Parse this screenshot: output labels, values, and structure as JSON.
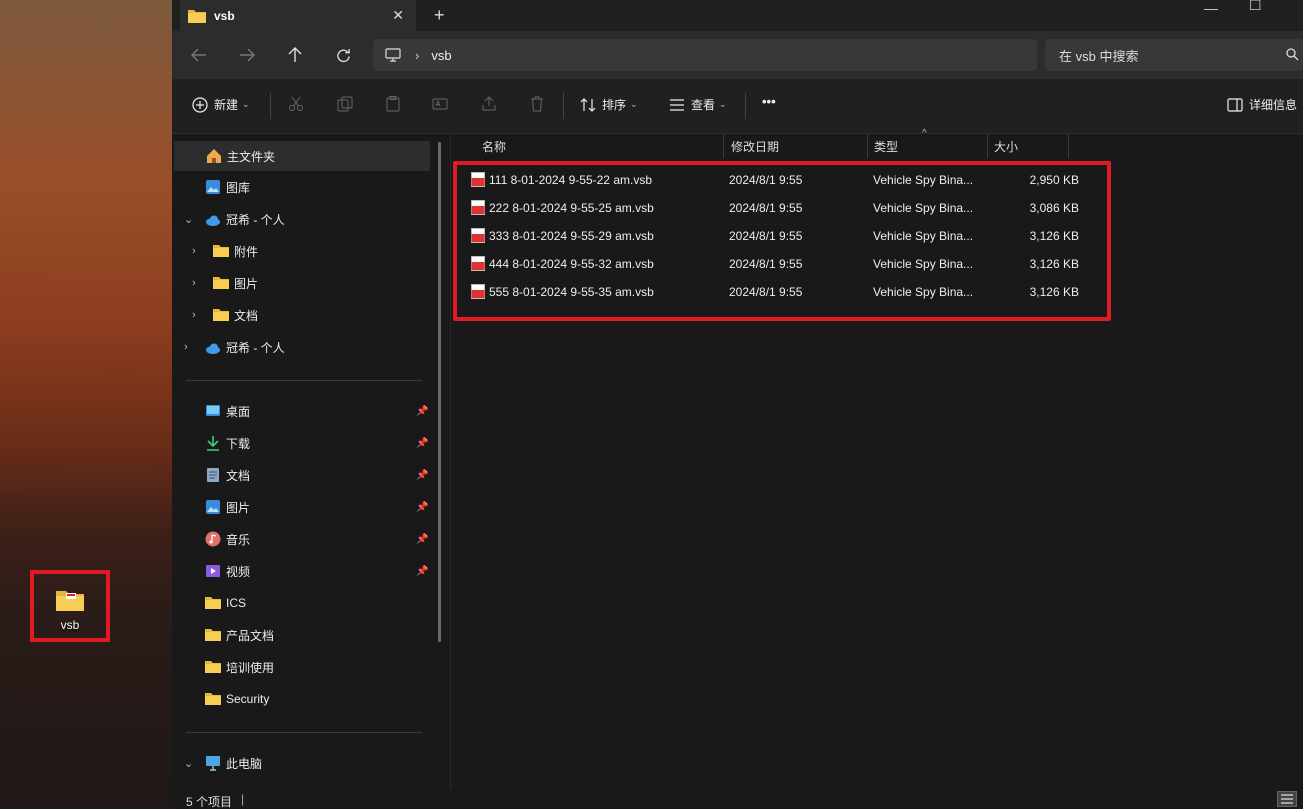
{
  "desktop": {
    "icon_label": "vsb"
  },
  "tab": {
    "title": "vsb",
    "close": "✕",
    "new": "+"
  },
  "window_controls": {
    "minimize": "—",
    "maximize": "☐"
  },
  "address": {
    "path": "vsb"
  },
  "search": {
    "placeholder": "在 vsb 中搜索"
  },
  "toolbar": {
    "new_label": "新建",
    "sort_label": "排序",
    "view_label": "查看",
    "more_label": "•••",
    "details_label": "详细信息"
  },
  "sidebar": {
    "home": "主文件夹",
    "gallery": "图库",
    "onedrive_1": "冠希 - 个人",
    "attachments": "附件",
    "pictures_sub": "图片",
    "documents_sub": "文档",
    "onedrive_2": "冠希 - 个人",
    "desktop": "桌面",
    "downloads": "下载",
    "documents": "文档",
    "pictures": "图片",
    "music": "音乐",
    "videos": "视频",
    "ics": "ICS",
    "product_docs": "产品文档",
    "training": "培训使用",
    "security": "Security",
    "this_pc": "此电脑"
  },
  "columns": {
    "name": "名称",
    "modified": "修改日期",
    "type": "类型",
    "size": "大小"
  },
  "files": [
    {
      "name": "111 8-01-2024 9-55-22 am.vsb",
      "modified": "2024/8/1 9:55",
      "type": "Vehicle Spy Bina...",
      "size": "2,950 KB"
    },
    {
      "name": "222 8-01-2024 9-55-25 am.vsb",
      "modified": "2024/8/1 9:55",
      "type": "Vehicle Spy Bina...",
      "size": "3,086 KB"
    },
    {
      "name": "333 8-01-2024 9-55-29 am.vsb",
      "modified": "2024/8/1 9:55",
      "type": "Vehicle Spy Bina...",
      "size": "3,126 KB"
    },
    {
      "name": "444 8-01-2024 9-55-32 am.vsb",
      "modified": "2024/8/1 9:55",
      "type": "Vehicle Spy Bina...",
      "size": "3,126 KB"
    },
    {
      "name": "555 8-01-2024 9-55-35 am.vsb",
      "modified": "2024/8/1 9:55",
      "type": "Vehicle Spy Bina...",
      "size": "3,126 KB"
    }
  ],
  "status": {
    "count": "5 个项目"
  },
  "colors": {
    "highlight": "#e01b24",
    "folder": "#f4c542",
    "accent": "#4cc2ff"
  }
}
